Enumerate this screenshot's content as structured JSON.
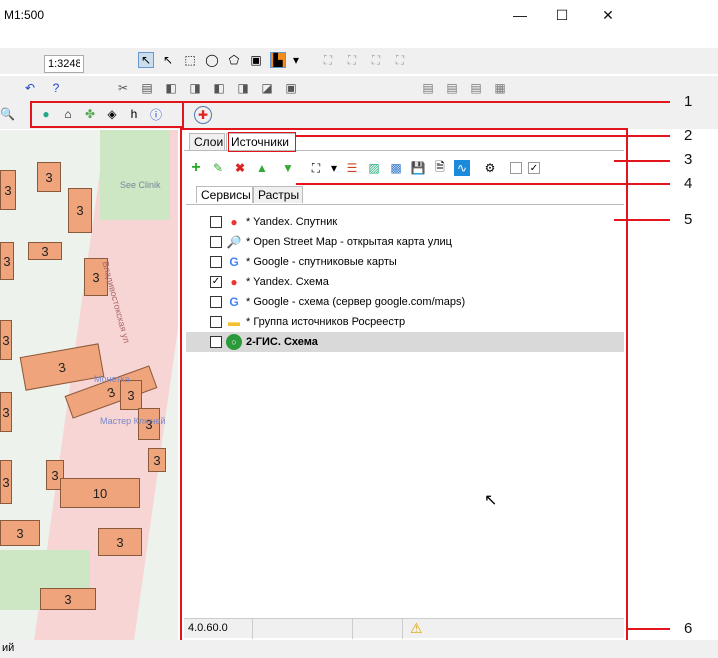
{
  "window": {
    "title": "M1:500",
    "minimize": "—",
    "maximize": "☐",
    "close": "✕"
  },
  "scale_value": "1:3248",
  "map_labels": {
    "clinic": "See Clinik",
    "street": "Владивостокская ул",
    "shop": "Монетка",
    "master": "Мастер Ключей"
  },
  "map_numbers": [
    "3",
    "3",
    "3",
    "3",
    "3",
    "3",
    "3",
    "3",
    "3",
    "3",
    "3",
    "3",
    "3",
    "10",
    "3",
    "3",
    "3",
    "3",
    "3"
  ],
  "tabs": [
    "Слои",
    "Источники"
  ],
  "subtabs": [
    "Сервисы",
    "Растры"
  ],
  "sources": [
    {
      "label": "* Yandex. Спутник",
      "checked": false,
      "icon": "yandex-pin-icon",
      "bold": false
    },
    {
      "label": "* Open Street Map - открытая карта улиц",
      "checked": false,
      "icon": "osm-magnifier-icon",
      "bold": false
    },
    {
      "label": "* Google - спутниковые карты",
      "checked": false,
      "icon": "google-g-icon",
      "bold": false
    },
    {
      "label": "* Yandex. Схема",
      "checked": true,
      "icon": "yandex-pin-icon",
      "bold": false
    },
    {
      "label": "* Google - схема (сервер google.com/maps)",
      "checked": false,
      "icon": "google-g-icon",
      "bold": false
    },
    {
      "label": "* Группа источников Росреестр",
      "checked": false,
      "icon": "folder-icon",
      "bold": false
    },
    {
      "label": "2-ГИС. Схема",
      "checked": false,
      "icon": "2gis-icon",
      "bold": true
    }
  ],
  "status": {
    "version": "4.0.60.0"
  },
  "callouts": [
    "1",
    "2",
    "3",
    "4",
    "5",
    "6"
  ],
  "bottom_text": "ий",
  "colors": {
    "callout": "#e2141c",
    "selected_row": "#d9d9d9"
  }
}
